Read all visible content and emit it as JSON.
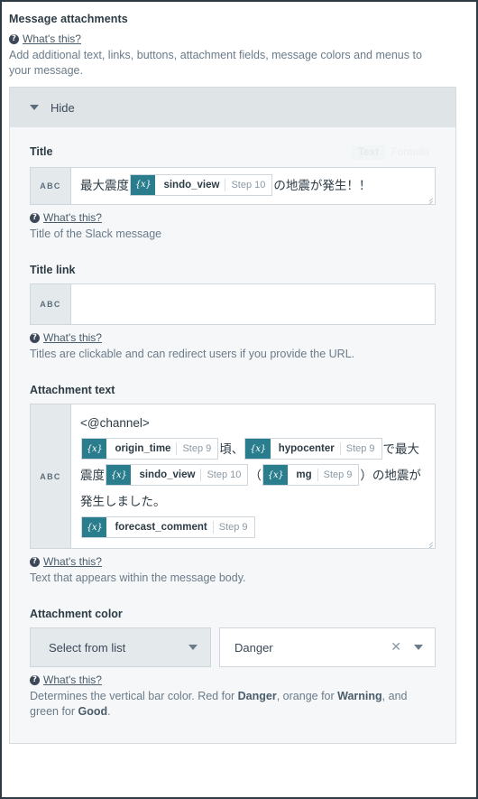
{
  "section": {
    "title": "Message attachments",
    "help_label": "What's this?",
    "help_icon": "question-circle-icon",
    "description": "Add additional text, links, buttons, attachment fields, message colors and menus to your message."
  },
  "panel": {
    "toggle_label": "Hide",
    "toggle_icon": "chevron-down-icon"
  },
  "fields": {
    "title": {
      "label": "Title",
      "gutter_label": "ABC",
      "mode_toggle": {
        "text_label": "Text",
        "formula_label": "Formula"
      },
      "value_parts": [
        {
          "type": "text",
          "text": "最大震度"
        },
        {
          "type": "token",
          "prefix": "{x}",
          "name": "sindo_view",
          "step": "Step 10"
        },
        {
          "type": "text",
          "text": "の地震が発生！！"
        }
      ],
      "help_label": "What's this?",
      "description": "Title of the Slack message"
    },
    "title_link": {
      "label": "Title link",
      "gutter_label": "ABC",
      "value": "",
      "help_label": "What's this?",
      "description": "Titles are clickable and can redirect users if you provide the URL."
    },
    "attachment_text": {
      "label": "Attachment text",
      "gutter_label": "ABC",
      "lines": [
        [
          {
            "type": "text",
            "text": "<@channel>"
          }
        ],
        [
          {
            "type": "token",
            "prefix": "{x}",
            "name": "origin_time",
            "step": "Step 9"
          },
          {
            "type": "text",
            "text": "頃、"
          },
          {
            "type": "token",
            "prefix": "{x}",
            "name": "hypocenter",
            "step": "Step 9"
          },
          {
            "type": "text",
            "text": "で最大震度"
          },
          {
            "type": "token",
            "prefix": "{x}",
            "name": "sindo_view",
            "step": "Step 10"
          },
          {
            "type": "text",
            "text": "（"
          },
          {
            "type": "token",
            "prefix": "{x}",
            "name": "mg",
            "step": "Step 9"
          },
          {
            "type": "text",
            "text": "）の地震が発生しました。"
          }
        ],
        [
          {
            "type": "token",
            "prefix": "{x}",
            "name": "forecast_comment",
            "step": "Step 9"
          }
        ]
      ],
      "help_label": "What's this?",
      "description": "Text that appears within the message body."
    },
    "attachment_color": {
      "label": "Attachment color",
      "source_select_value": "Select from list",
      "value_select_value": "Danger",
      "clear_icon": "close-x-icon",
      "help_label": "What's this?",
      "description_parts": [
        {
          "type": "text",
          "text": "Determines the vertical bar color. Red for "
        },
        {
          "type": "bold",
          "text": "Danger"
        },
        {
          "type": "text",
          "text": ", orange for "
        },
        {
          "type": "bold",
          "text": "Warning"
        },
        {
          "type": "text",
          "text": ", and green for "
        },
        {
          "type": "bold",
          "text": "Good"
        },
        {
          "type": "text",
          "text": "."
        }
      ]
    }
  },
  "colors": {
    "token_accent": "#2a7d8c",
    "panel_header_bg": "#dfe4e7",
    "panel_bg": "#f5f7f8",
    "border": "#cfd7dc",
    "text": "#2d3b45",
    "muted": "#6b7b8a"
  }
}
